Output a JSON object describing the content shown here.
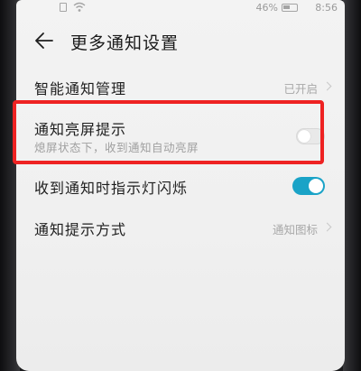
{
  "statusbar": {
    "battery_percent": "46%",
    "time": "8:56",
    "icons": [
      "sim-icon",
      "wifi-icon",
      "battery-icon"
    ]
  },
  "header": {
    "title": "更多通知设置",
    "back_icon": "back-arrow-icon"
  },
  "settings": [
    {
      "title": "智能通知管理",
      "value": "已开启",
      "control": "chevron"
    },
    {
      "title": "通知亮屏提示",
      "subtitle": "熄屏状态下，收到通知自动亮屏",
      "control": "toggle",
      "on": false
    },
    {
      "title": "收到通知时指示灯闪烁",
      "control": "toggle",
      "on": true
    },
    {
      "title": "通知提示方式",
      "value": "通知图标",
      "control": "chevron"
    }
  ],
  "colors": {
    "toggle_on": "#1aa3c7",
    "highlight": "#ee2222"
  }
}
